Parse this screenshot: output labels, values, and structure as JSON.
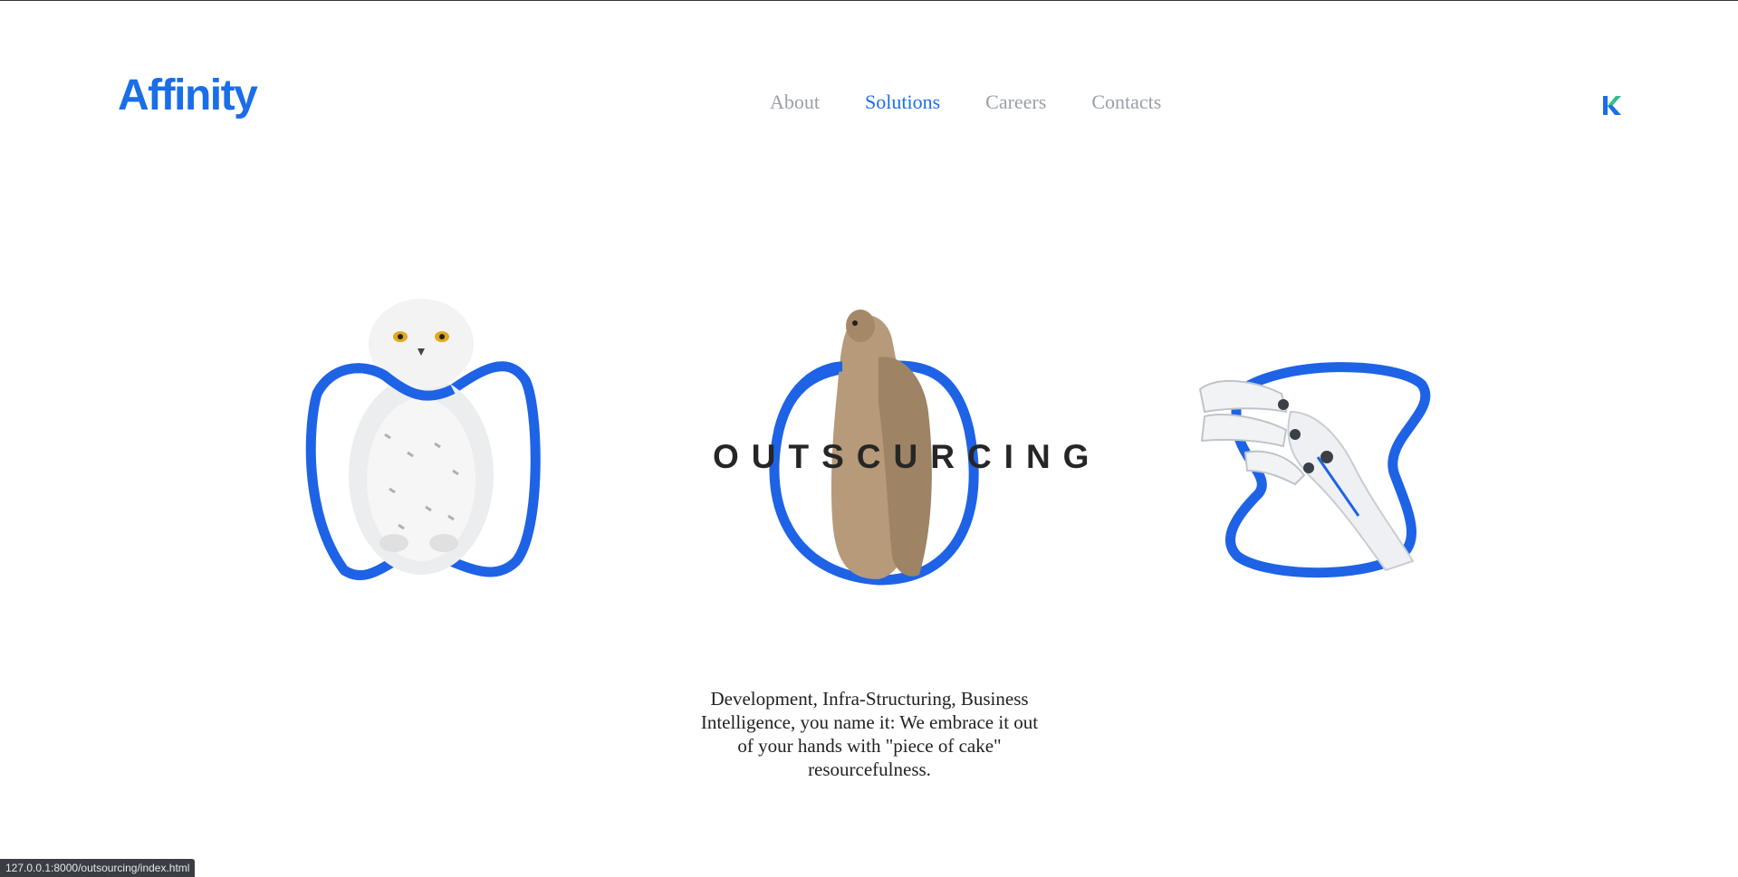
{
  "header": {
    "logo": "Affinity",
    "nav": [
      {
        "label": "About",
        "active": false
      },
      {
        "label": "Solutions",
        "active": true
      },
      {
        "label": "Careers",
        "active": false
      },
      {
        "label": "Contacts",
        "active": false
      }
    ],
    "brand_mark_icon": "k-logo-icon"
  },
  "hero": {
    "headline": "OUTSCURCING",
    "description": "Development, Infra-Structuring, Business Intelligence, you name it: We embrace it out of your hands with \"piece of cake\" resourcefulness.",
    "cards": [
      {
        "name": "owl-image",
        "icon": "snowy-owl"
      },
      {
        "name": "meerkat-image",
        "icon": "meerkats-hugging"
      },
      {
        "name": "robot-hand-image",
        "icon": "robotic-hand"
      }
    ]
  },
  "status_bar": {
    "url": "127.0.0.1:8000/outsourcing/index.html"
  },
  "colors": {
    "accent": "#1a6ee8",
    "nav_inactive": "#9aa0a8",
    "text": "#222222"
  }
}
